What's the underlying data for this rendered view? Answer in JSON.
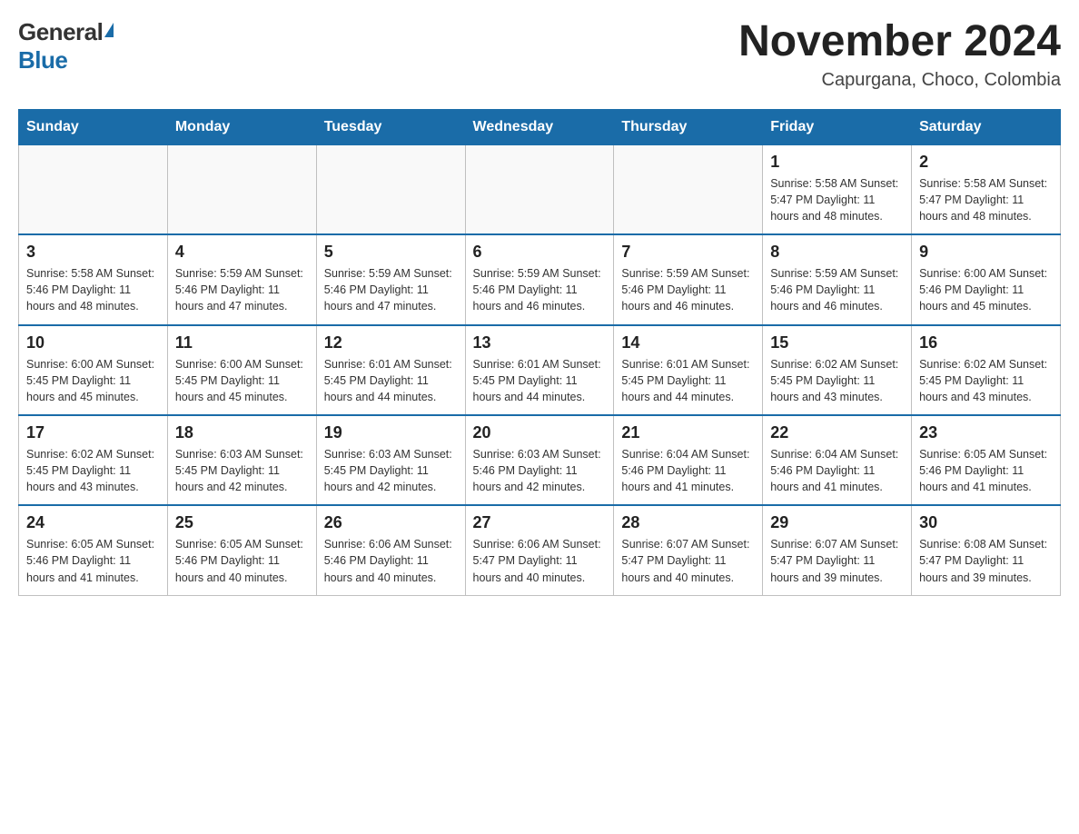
{
  "header": {
    "logo_general": "General",
    "logo_blue": "Blue",
    "month_title": "November 2024",
    "location": "Capurgana, Choco, Colombia"
  },
  "weekdays": [
    "Sunday",
    "Monday",
    "Tuesday",
    "Wednesday",
    "Thursday",
    "Friday",
    "Saturday"
  ],
  "weeks": [
    [
      {
        "day": "",
        "info": ""
      },
      {
        "day": "",
        "info": ""
      },
      {
        "day": "",
        "info": ""
      },
      {
        "day": "",
        "info": ""
      },
      {
        "day": "",
        "info": ""
      },
      {
        "day": "1",
        "info": "Sunrise: 5:58 AM\nSunset: 5:47 PM\nDaylight: 11 hours\nand 48 minutes."
      },
      {
        "day": "2",
        "info": "Sunrise: 5:58 AM\nSunset: 5:47 PM\nDaylight: 11 hours\nand 48 minutes."
      }
    ],
    [
      {
        "day": "3",
        "info": "Sunrise: 5:58 AM\nSunset: 5:46 PM\nDaylight: 11 hours\nand 48 minutes."
      },
      {
        "day": "4",
        "info": "Sunrise: 5:59 AM\nSunset: 5:46 PM\nDaylight: 11 hours\nand 47 minutes."
      },
      {
        "day": "5",
        "info": "Sunrise: 5:59 AM\nSunset: 5:46 PM\nDaylight: 11 hours\nand 47 minutes."
      },
      {
        "day": "6",
        "info": "Sunrise: 5:59 AM\nSunset: 5:46 PM\nDaylight: 11 hours\nand 46 minutes."
      },
      {
        "day": "7",
        "info": "Sunrise: 5:59 AM\nSunset: 5:46 PM\nDaylight: 11 hours\nand 46 minutes."
      },
      {
        "day": "8",
        "info": "Sunrise: 5:59 AM\nSunset: 5:46 PM\nDaylight: 11 hours\nand 46 minutes."
      },
      {
        "day": "9",
        "info": "Sunrise: 6:00 AM\nSunset: 5:46 PM\nDaylight: 11 hours\nand 45 minutes."
      }
    ],
    [
      {
        "day": "10",
        "info": "Sunrise: 6:00 AM\nSunset: 5:45 PM\nDaylight: 11 hours\nand 45 minutes."
      },
      {
        "day": "11",
        "info": "Sunrise: 6:00 AM\nSunset: 5:45 PM\nDaylight: 11 hours\nand 45 minutes."
      },
      {
        "day": "12",
        "info": "Sunrise: 6:01 AM\nSunset: 5:45 PM\nDaylight: 11 hours\nand 44 minutes."
      },
      {
        "day": "13",
        "info": "Sunrise: 6:01 AM\nSunset: 5:45 PM\nDaylight: 11 hours\nand 44 minutes."
      },
      {
        "day": "14",
        "info": "Sunrise: 6:01 AM\nSunset: 5:45 PM\nDaylight: 11 hours\nand 44 minutes."
      },
      {
        "day": "15",
        "info": "Sunrise: 6:02 AM\nSunset: 5:45 PM\nDaylight: 11 hours\nand 43 minutes."
      },
      {
        "day": "16",
        "info": "Sunrise: 6:02 AM\nSunset: 5:45 PM\nDaylight: 11 hours\nand 43 minutes."
      }
    ],
    [
      {
        "day": "17",
        "info": "Sunrise: 6:02 AM\nSunset: 5:45 PM\nDaylight: 11 hours\nand 43 minutes."
      },
      {
        "day": "18",
        "info": "Sunrise: 6:03 AM\nSunset: 5:45 PM\nDaylight: 11 hours\nand 42 minutes."
      },
      {
        "day": "19",
        "info": "Sunrise: 6:03 AM\nSunset: 5:45 PM\nDaylight: 11 hours\nand 42 minutes."
      },
      {
        "day": "20",
        "info": "Sunrise: 6:03 AM\nSunset: 5:46 PM\nDaylight: 11 hours\nand 42 minutes."
      },
      {
        "day": "21",
        "info": "Sunrise: 6:04 AM\nSunset: 5:46 PM\nDaylight: 11 hours\nand 41 minutes."
      },
      {
        "day": "22",
        "info": "Sunrise: 6:04 AM\nSunset: 5:46 PM\nDaylight: 11 hours\nand 41 minutes."
      },
      {
        "day": "23",
        "info": "Sunrise: 6:05 AM\nSunset: 5:46 PM\nDaylight: 11 hours\nand 41 minutes."
      }
    ],
    [
      {
        "day": "24",
        "info": "Sunrise: 6:05 AM\nSunset: 5:46 PM\nDaylight: 11 hours\nand 41 minutes."
      },
      {
        "day": "25",
        "info": "Sunrise: 6:05 AM\nSunset: 5:46 PM\nDaylight: 11 hours\nand 40 minutes."
      },
      {
        "day": "26",
        "info": "Sunrise: 6:06 AM\nSunset: 5:46 PM\nDaylight: 11 hours\nand 40 minutes."
      },
      {
        "day": "27",
        "info": "Sunrise: 6:06 AM\nSunset: 5:47 PM\nDaylight: 11 hours\nand 40 minutes."
      },
      {
        "day": "28",
        "info": "Sunrise: 6:07 AM\nSunset: 5:47 PM\nDaylight: 11 hours\nand 40 minutes."
      },
      {
        "day": "29",
        "info": "Sunrise: 6:07 AM\nSunset: 5:47 PM\nDaylight: 11 hours\nand 39 minutes."
      },
      {
        "day": "30",
        "info": "Sunrise: 6:08 AM\nSunset: 5:47 PM\nDaylight: 11 hours\nand 39 minutes."
      }
    ]
  ]
}
